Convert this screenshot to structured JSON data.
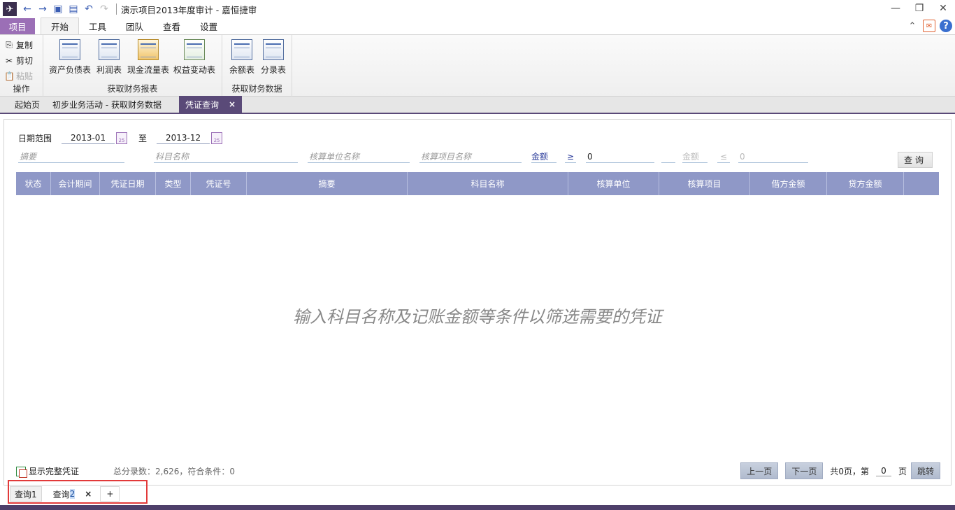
{
  "title": "演示项目2013年度审计 - 嘉恒捷审",
  "ribbon_tabs": {
    "project": "项目",
    "tabs": [
      "开始",
      "工具",
      "团队",
      "查看",
      "设置"
    ]
  },
  "ribbon": {
    "clipboard": {
      "copy": "复制",
      "cut": "剪切",
      "paste": "粘贴",
      "group": "操作"
    },
    "reports": {
      "balance_sheet": "资产负债表",
      "income": "利润表",
      "cashflow": "现金流量表",
      "equity": "权益变动表",
      "group": "获取财务报表"
    },
    "data": {
      "balance": "余额表",
      "journal": "分录表",
      "group": "获取财务数据"
    }
  },
  "doc_tabs": {
    "home": "起始页",
    "activity": "初步业务活动 - 获取财务数据",
    "active": "凭证查询",
    "close": "×"
  },
  "filters": {
    "date_label": "日期范围",
    "date_from": "2013-01",
    "date_to": "2013-12",
    "to_label": "至",
    "cal_day": "25",
    "summary_placeholder": "摘要",
    "account_placeholder": "科目名称",
    "unit_placeholder": "核算单位名称",
    "item_placeholder": "核算项目名称",
    "amount_label": "金额",
    "ge": "≥",
    "amount_min": "0",
    "amount2_label": "金额",
    "le": "≤",
    "amount_max": "0",
    "query_button": "查询"
  },
  "table": {
    "columns": [
      "状态",
      "会计期间",
      "凭证日期",
      "类型",
      "凭证号",
      "摘要",
      "科目名称",
      "核算单位",
      "核算项目",
      "借方金额",
      "贷方金额"
    ]
  },
  "placeholder_message": "输入科目名称及记账金额等条件以筛选需要的凭证",
  "footer": {
    "show_full": "显示完整凭证",
    "stats": "总分录数：2,626，符合条件：0",
    "prev": "上一页",
    "next": "下一页",
    "total_prefix": "共0页，第",
    "page_num": "0",
    "page_suffix": "页",
    "jump": "跳转"
  },
  "query_tabs": {
    "tab1": "查询1",
    "tab2_text": "查询",
    "tab2_num": "2",
    "close": "×",
    "add": "+"
  },
  "colors": {
    "accent": "#5a4a78",
    "project_tab": "#9b6fb6",
    "table_header": "#8f98c7",
    "highlight": "#e23a3a"
  }
}
